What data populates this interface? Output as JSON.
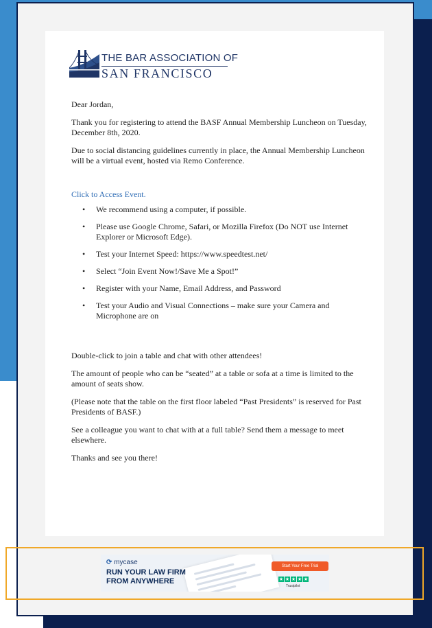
{
  "logo": {
    "line1": "THE BAR ASSOCIATION OF",
    "line2": "SAN FRANCISCO",
    "icon": "golden-gate-bridge-icon"
  },
  "letter": {
    "greeting": "Dear Jordan,",
    "para1": "Thank you for registering to attend the BASF Annual Membership Luncheon on Tuesday, December 8th, 2020.",
    "para2": "Due to social distancing guidelines currently in place, the Annual Membership Luncheon will be a virtual event, hosted via Remo Conference.",
    "link_text": "Click to Access Event.",
    "steps": [
      "We recommend using a computer, if possible.",
      "Please use Google Chrome, Safari, or Mozilla Firefox (Do NOT use Internet Explorer or Microsoft Edge).",
      "Test your Internet Speed: https://www.speedtest.net/",
      "Select “Join Event Now!/Save Me a Spot!”",
      "Register with your Name, Email Address, and Password",
      "Test your Audio and Visual Connections – make sure your Camera and Microphone are on"
    ],
    "para3": "Double-click to join a table and chat with other attendees!",
    "para4": "The amount of people who can be “seated” at a table or sofa at a time is limited to the amount of seats show.",
    "para5": "(Please note that the table on the first floor labeled “Past Presidents” is reserved for Past Presidents of BASF.)",
    "para6": "See a colleague you want to chat with at a full table? Send them a message to meet elsewhere.",
    "closing": "Thanks and see you there!"
  },
  "ad": {
    "brand": "mycase",
    "headline_line1": "RUN YOUR LAW FIRM",
    "headline_line2": "FROM ANYWHERE",
    "cta": "Start Your Free Trial",
    "rating_label": "Trustpilot",
    "rating_stars": 5
  },
  "colors": {
    "background_blue": "#3a8ccc",
    "background_navy": "#0b1f4e",
    "link": "#2f6db5",
    "ad_frame": "#f0a828",
    "cta": "#f05a28",
    "trustpilot_green": "#00b67a"
  }
}
